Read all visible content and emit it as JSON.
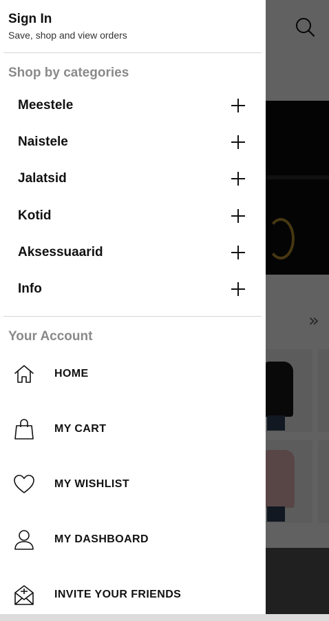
{
  "header": {
    "signin_title": "Sign In",
    "signin_subtitle": "Save, shop and view orders"
  },
  "categories": {
    "title": "Shop by categories",
    "items": [
      {
        "label": "Meestele"
      },
      {
        "label": "Naistele"
      },
      {
        "label": "Jalatsid"
      },
      {
        "label": "Kotid"
      },
      {
        "label": "Aksessuaarid"
      },
      {
        "label": "Info"
      }
    ]
  },
  "account": {
    "title": "Your Account",
    "items": [
      {
        "label": "HOME",
        "icon": "home-icon"
      },
      {
        "label": "MY CART",
        "icon": "shopping-bag-icon"
      },
      {
        "label": "MY WISHLIST",
        "icon": "heart-icon"
      },
      {
        "label": "MY DASHBOARD",
        "icon": "user-icon"
      },
      {
        "label": "INVITE YOUR FRIENDS",
        "icon": "invite-mail-icon"
      }
    ]
  },
  "background": {
    "search_icon": "search-icon",
    "more_icon": "double-chevron-right-icon"
  },
  "colors": {
    "section_title": "#8a8a8a",
    "text": "#111111",
    "divider": "#d6d6d6",
    "scrim": "rgba(0,0,0,0.62)"
  }
}
